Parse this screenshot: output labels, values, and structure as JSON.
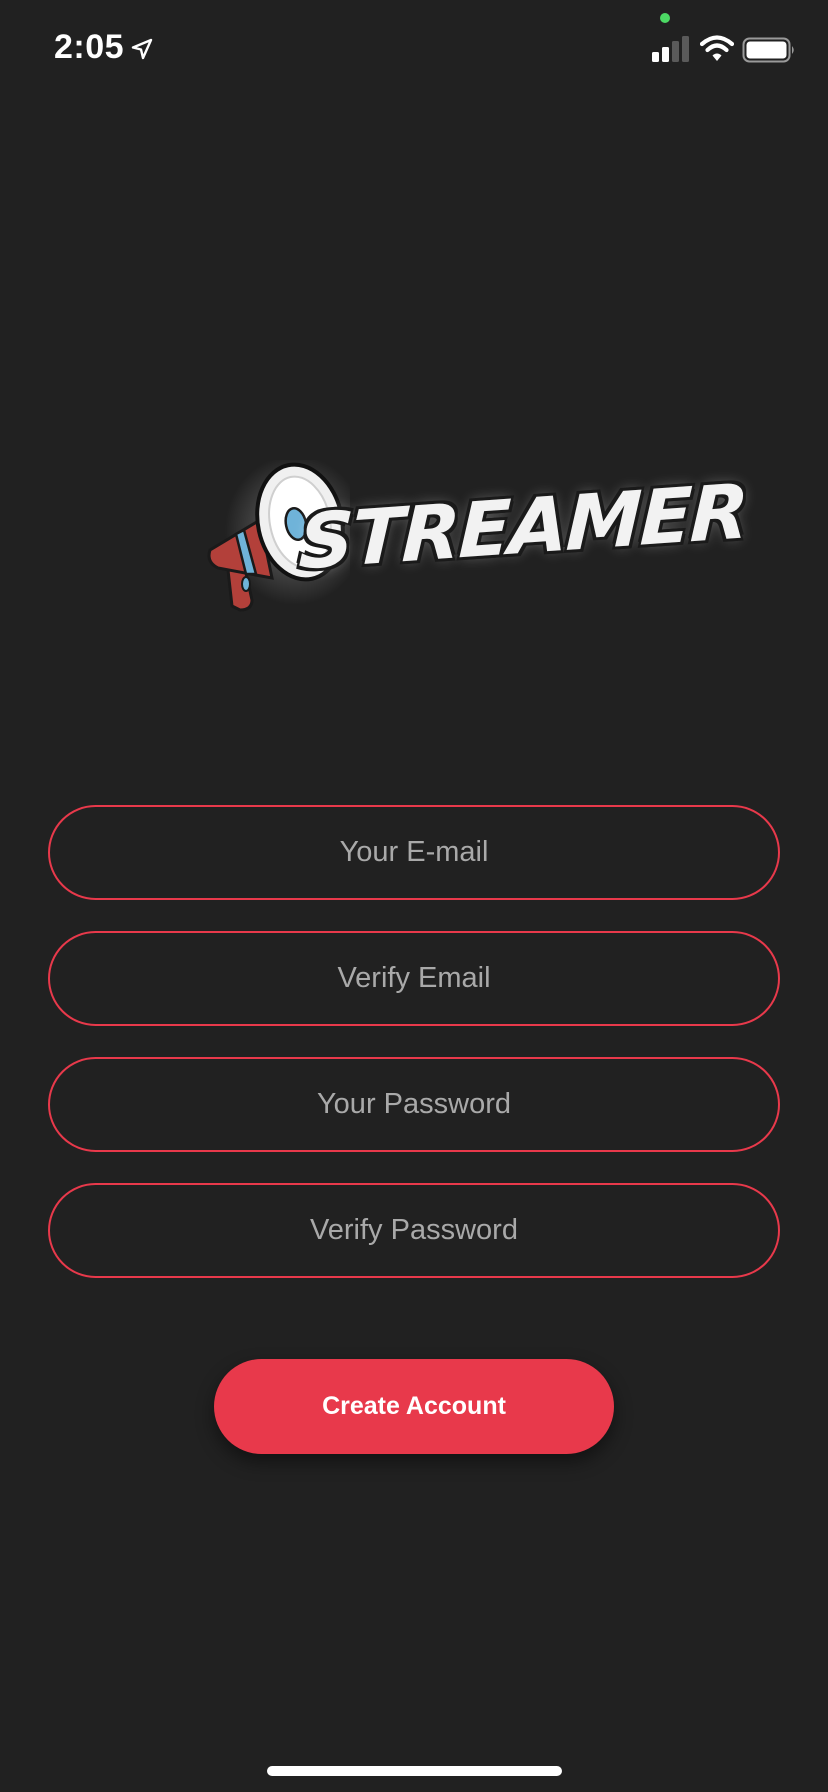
{
  "status_bar": {
    "time": "2:05",
    "camera_indicator_color": "#4cd964",
    "icons": [
      "location-arrow-icon",
      "cellular-signal-icon",
      "wifi-icon",
      "battery-icon"
    ]
  },
  "logo": {
    "wordmark": "STREAMER",
    "icon": "megaphone-icon"
  },
  "form": {
    "email_placeholder": "Your E-mail",
    "verify_email_placeholder": "Verify Email",
    "password_placeholder": "Your Password",
    "verify_password_placeholder": "Verify Password",
    "create_account_label": "Create Account"
  },
  "colors": {
    "background": "#212121",
    "accent": "#e8394b",
    "placeholder_text": "#a9a9a9"
  }
}
